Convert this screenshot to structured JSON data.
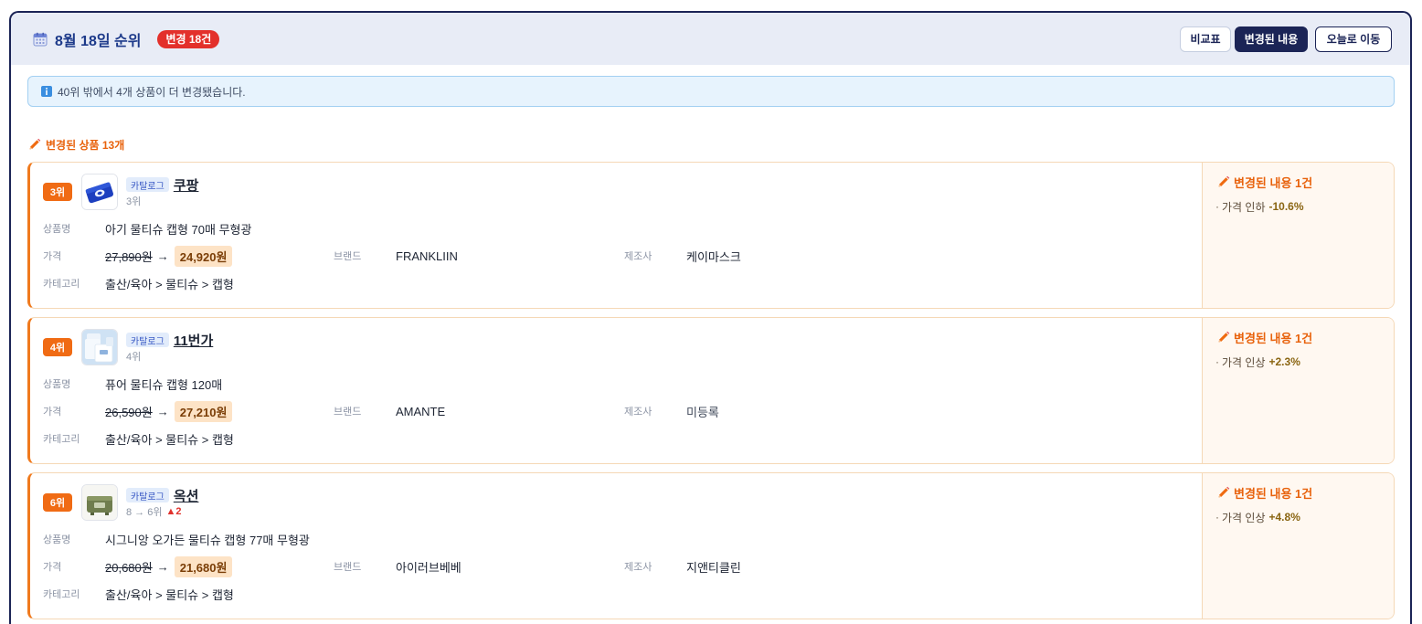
{
  "colors": {
    "frame_border": "#1b2456",
    "header_bg": "#e8ecf6",
    "title": "#1d3a8a",
    "accent_orange": "#ef6a10",
    "badge_red": "#e3302b",
    "info_bg": "#e7f3fd",
    "price_highlight_bg": "#fde3c6",
    "change_value": "#8a6512"
  },
  "header": {
    "icon": "calendar-icon",
    "title": "8월 18일 순위",
    "change_badge": "변경 18건",
    "buttons": [
      {
        "label": "비교표",
        "active": false
      },
      {
        "label": "변경된 내용",
        "active": true
      },
      {
        "label": "오늘로 이동",
        "active": false
      }
    ]
  },
  "notice": {
    "icon": "info-icon",
    "text": "40위 밖에서 4개 상품이 더 변경됐습니다."
  },
  "section": {
    "icon": "pencil-icon",
    "label": "변경된 상품 13개"
  },
  "field_labels": {
    "name": "상품명",
    "price": "가격",
    "brand": "브랜드",
    "maker": "제조사",
    "category": "카테고리",
    "price_arrow": "→"
  },
  "cards": [
    {
      "rank_badge": "3위",
      "tag": "카탈로그",
      "store": "쿠팡",
      "rank_detail": "3위",
      "rank_change": "",
      "product_name": "아기 물티슈 캡형 70매 무형광",
      "old_price": "27,890원",
      "new_price": "24,920원",
      "brand": "FRANKLIIN",
      "maker": "케이마스크",
      "category": "출산/육아 > 물티슈 > 캡형",
      "changes_title": "변경된 내용 1건",
      "changes": [
        {
          "label": "가격 인하",
          "value": "-10.6%"
        }
      ]
    },
    {
      "rank_badge": "4위",
      "tag": "카탈로그",
      "store": "11번가",
      "rank_detail": "4위",
      "rank_change": "",
      "product_name": "퓨어 물티슈 캡형 120매",
      "old_price": "26,590원",
      "new_price": "27,210원",
      "brand": "AMANTE",
      "maker": "미등록",
      "category": "출산/육아 > 물티슈 > 캡형",
      "changes_title": "변경된 내용 1건",
      "changes": [
        {
          "label": "가격 인상",
          "value": "+2.3%"
        }
      ]
    },
    {
      "rank_badge": "6위",
      "tag": "카탈로그",
      "store": "옥션",
      "rank_detail": "8 → 6위",
      "rank_change": "▲2",
      "product_name": "시그니앙 오가든 물티슈 캡형 77매 무형광",
      "old_price": "20,680원",
      "new_price": "21,680원",
      "brand": "아이러브베베",
      "maker": "지앤티클린",
      "category": "출산/육아 > 물티슈 > 캡형",
      "changes_title": "변경된 내용 1건",
      "changes": [
        {
          "label": "가격 인상",
          "value": "+4.8%"
        }
      ]
    }
  ]
}
